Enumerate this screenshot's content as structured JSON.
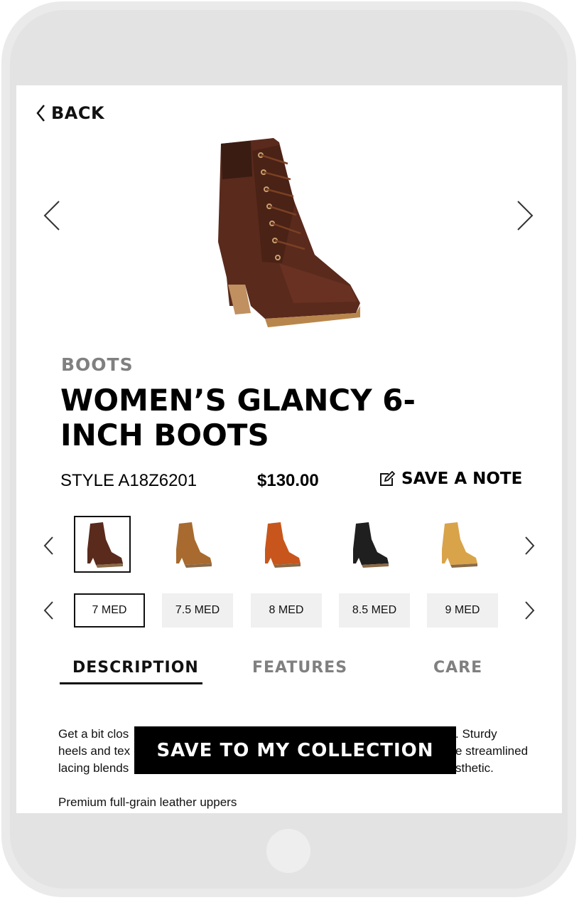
{
  "nav": {
    "back_label": "BACK"
  },
  "product": {
    "category": "BOOTS",
    "title": "WOMEN’S GLANCY 6-INCH BOOTS",
    "style": "STYLE A18Z6201",
    "price": "$130.00",
    "save_note_label": "SAVE A NOTE"
  },
  "colors": [
    {
      "name": "dark-brown",
      "hex": "#5a2a1c",
      "selected": true
    },
    {
      "name": "tan",
      "hex": "#a86a2e",
      "selected": false
    },
    {
      "name": "rust-orange",
      "hex": "#c8561c",
      "selected": false
    },
    {
      "name": "black",
      "hex": "#1f1f1f",
      "selected": false
    },
    {
      "name": "wheat",
      "hex": "#d9a34a",
      "selected": false
    }
  ],
  "sizes": [
    {
      "label": "7 MED",
      "selected": true
    },
    {
      "label": "7.5 MED",
      "selected": false
    },
    {
      "label": "8 MED",
      "selected": false
    },
    {
      "label": "8.5 MED",
      "selected": false
    },
    {
      "label": "9 MED",
      "selected": false
    }
  ],
  "tabs": [
    {
      "label": "DESCRIPTION",
      "active": true
    },
    {
      "label": "FEATURES",
      "active": false
    },
    {
      "label": "CARE",
      "active": false
    }
  ],
  "description": {
    "lines": [
      "Get a bit clos",
      ". Sturdy",
      "heels and tex",
      "e streamlined",
      "lacing blends",
      "sthetic."
    ],
    "feature_line": "Premium full-grain leather uppers"
  },
  "cta_label": "SAVE TO MY COLLECTION",
  "theme": {
    "accent": "#000000",
    "muted": "#808080",
    "size_bg": "#f0f0f0",
    "device": "#e3e3e3"
  }
}
